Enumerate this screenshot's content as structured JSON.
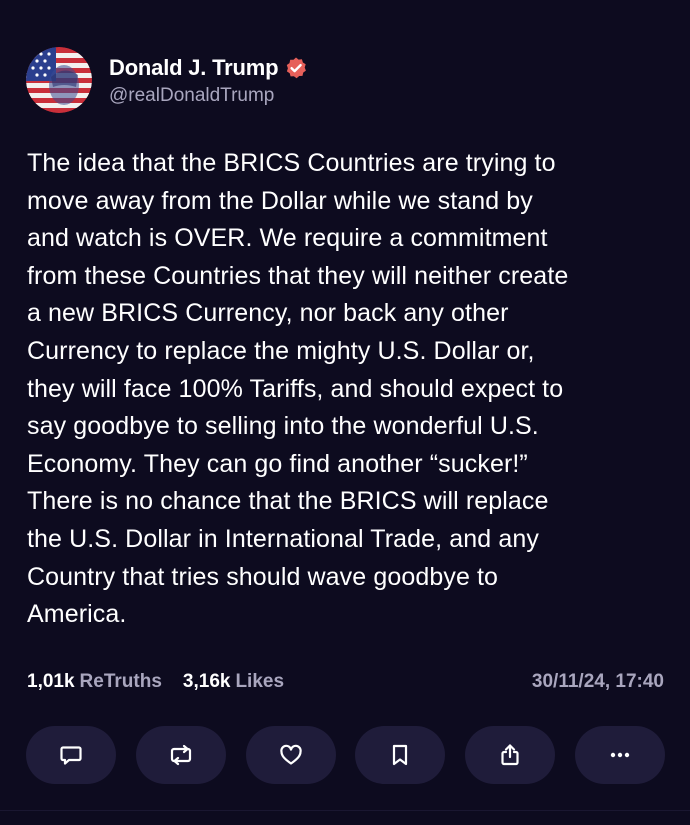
{
  "author": {
    "display_name": "Donald J. Trump",
    "handle": "@realDonaldTrump",
    "verified_badge_color": "#e6605a"
  },
  "post": {
    "lines": [
      "The idea that the BRICS Countries are trying to",
      "move away from the Dollar while we stand by",
      "and watch is OVER. We require a commitment",
      "from these Countries that they will neither create",
      "a new BRICS Currency, nor back any other",
      "Currency to replace the mighty U.S. Dollar or,",
      "they will face 100% Tariffs, and should expect to",
      "say goodbye to selling into the wonderful U.S.",
      "Economy. They can go find another “sucker!”",
      "There is no chance that the BRICS will replace",
      "the U.S. Dollar in International Trade, and any",
      "Country that tries should wave goodbye to",
      "America."
    ]
  },
  "stats": {
    "retruths_count": "1,01k",
    "retruths_label": "ReTruths",
    "likes_count": "3,16k",
    "likes_label": "Likes",
    "timestamp": "30/11/24, 17:40"
  },
  "actions": [
    {
      "name": "reply",
      "icon": "comment-icon"
    },
    {
      "name": "retruth",
      "icon": "repost-icon"
    },
    {
      "name": "like",
      "icon": "heart-icon"
    },
    {
      "name": "bookmark",
      "icon": "bookmark-icon"
    },
    {
      "name": "share",
      "icon": "share-icon"
    },
    {
      "name": "more",
      "icon": "more-icon"
    }
  ],
  "colors": {
    "background": "#0d0b1f",
    "button_background": "#1f1c3a",
    "muted_text": "#a9a6be"
  }
}
